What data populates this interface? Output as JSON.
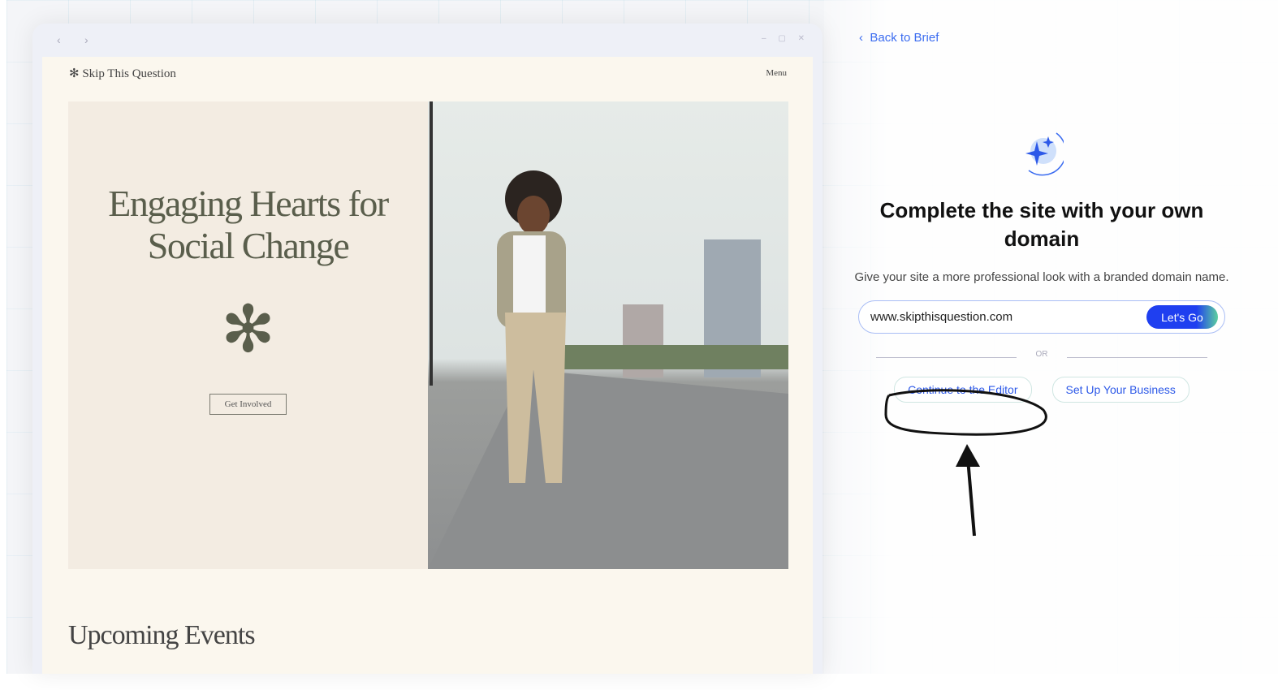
{
  "browser": {
    "back": "‹",
    "forward": "›",
    "controls": "– ▢ ✕"
  },
  "site": {
    "logo": "✻ Skip This Question",
    "menu": "Menu",
    "hero_title": "Engaging Hearts for Social Change",
    "asterisk": "✻",
    "cta": "Get Involved",
    "events_heading": "Upcoming Events"
  },
  "panel": {
    "back_label": "Back to Brief",
    "back_icon": "‹",
    "title": "Complete the site with your own domain",
    "subtitle": "Give your site a more professional look with a branded domain name.",
    "domain_value": "www.skipthisquestion.com",
    "go_label": "Let's Go",
    "or_label": "OR",
    "continue_label": "Continue to the Editor",
    "business_label": "Set Up Your Business"
  },
  "colors": {
    "accent": "#2d59e8",
    "hero_text": "#5a5e4c"
  }
}
